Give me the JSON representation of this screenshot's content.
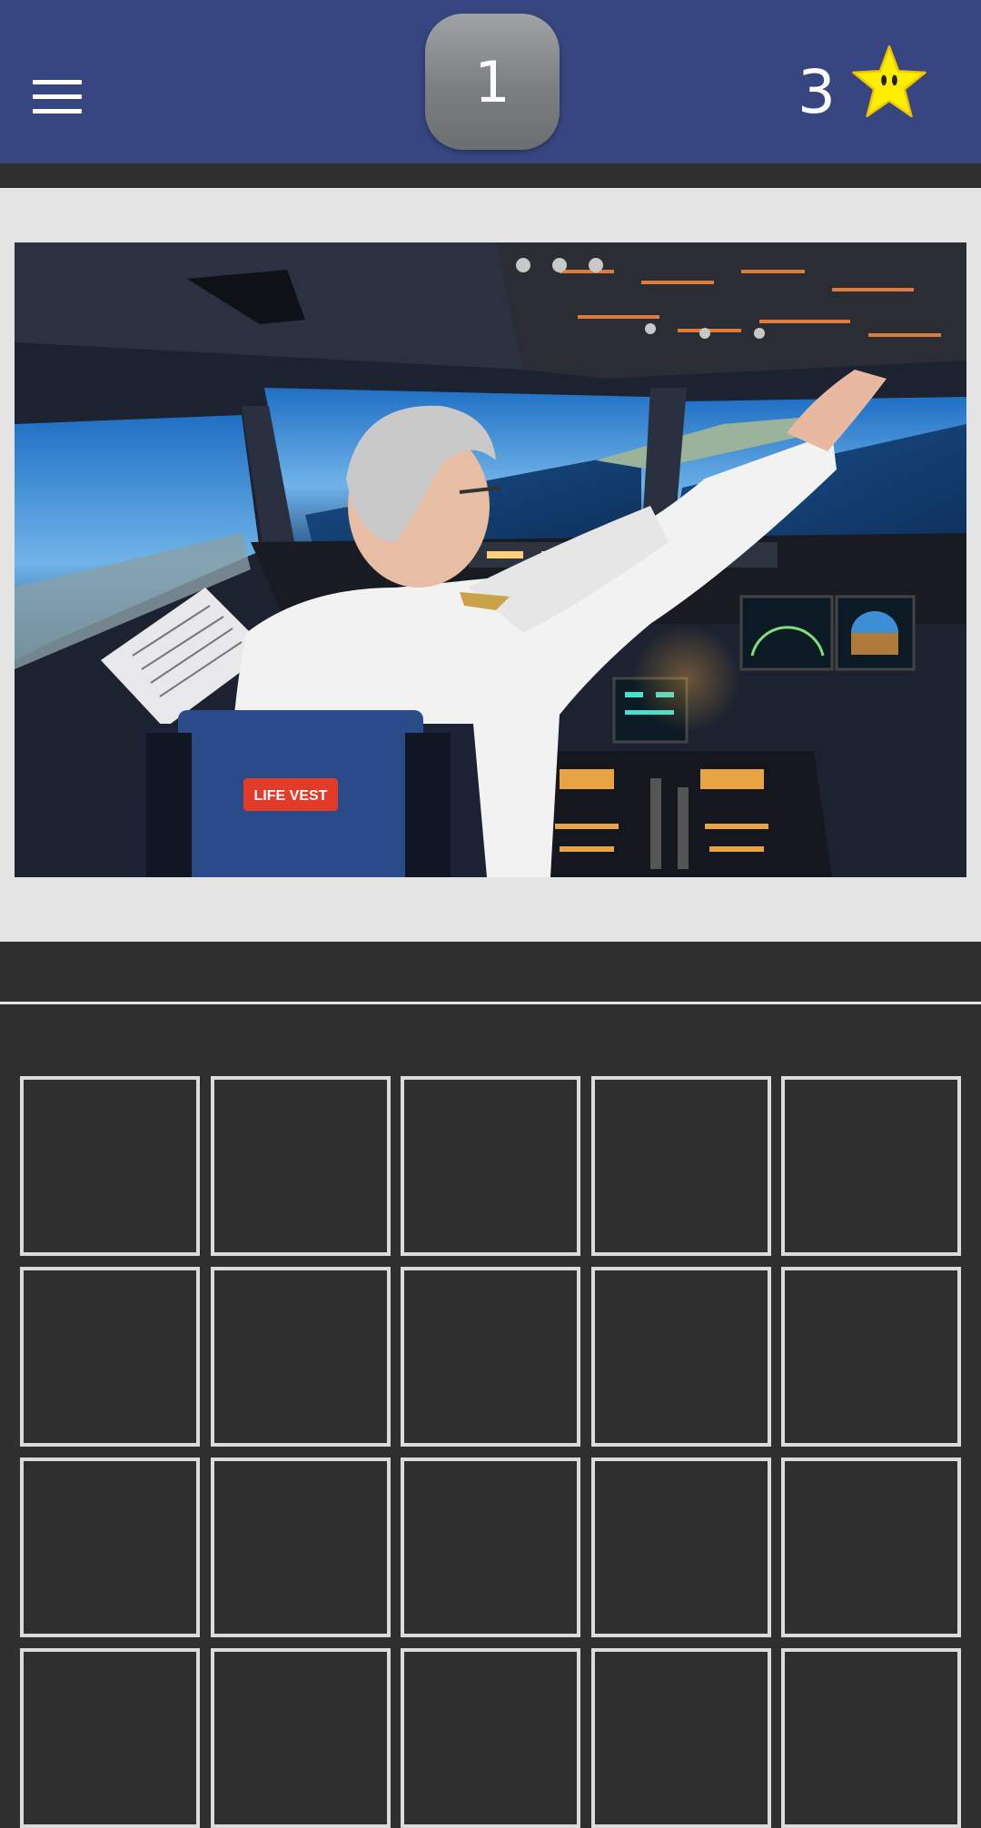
{
  "header": {
    "menu_icon": "hamburger-menu-icon",
    "level": "1",
    "star_count": "3",
    "star_icon": "star-icon"
  },
  "puzzle": {
    "image_icon": "cockpit-photo",
    "seat_label": "LIFE VEST"
  },
  "answer_grid": {
    "columns": 5,
    "cells": [
      "",
      "",
      "",
      "",
      "",
      "",
      "",
      "",
      "",
      "",
      "",
      "",
      "",
      "",
      "",
      "",
      "",
      "",
      "",
      ""
    ]
  },
  "colors": {
    "header_bg": "#374680",
    "page_bg": "#2f2f2f",
    "panel_bg": "#e4e4e4",
    "cell_border": "#dcdcdc",
    "star": "#ffee00"
  }
}
